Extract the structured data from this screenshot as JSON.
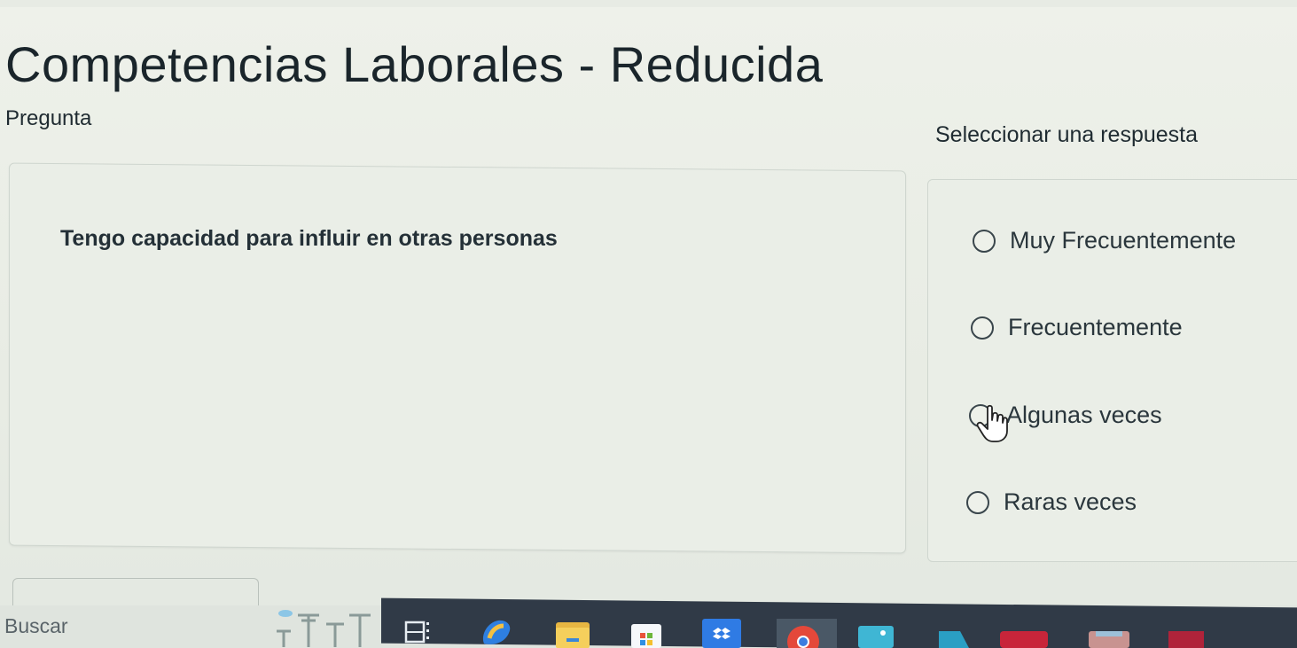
{
  "quiz": {
    "title": "Competencias Laborales - Reducida",
    "question_label": "Pregunta",
    "answer_prompt": "Seleccionar una respuesta",
    "question_text": "Tengo capacidad para influir en otras personas",
    "options": [
      {
        "label": "Muy Frecuentemente",
        "selected": false
      },
      {
        "label": "Frecuentemente",
        "selected": false
      },
      {
        "label": "Algunas veces",
        "selected": false
      },
      {
        "label": "Raras veces",
        "selected": false
      }
    ]
  },
  "taskbar": {
    "search_placeholder": "Buscar",
    "icons": [
      "scenery-widget-icon",
      "task-view-icon",
      "copilot-icon",
      "file-explorer-icon",
      "store-icon",
      "dropbox-icon",
      "chrome-icon",
      "photos-icon",
      "app-icon",
      "app-icon",
      "app-icon",
      "app-icon"
    ]
  },
  "colors": {
    "background": "#e9ede6",
    "text": "#1f2b31",
    "taskbar_dark": "#303a47"
  }
}
